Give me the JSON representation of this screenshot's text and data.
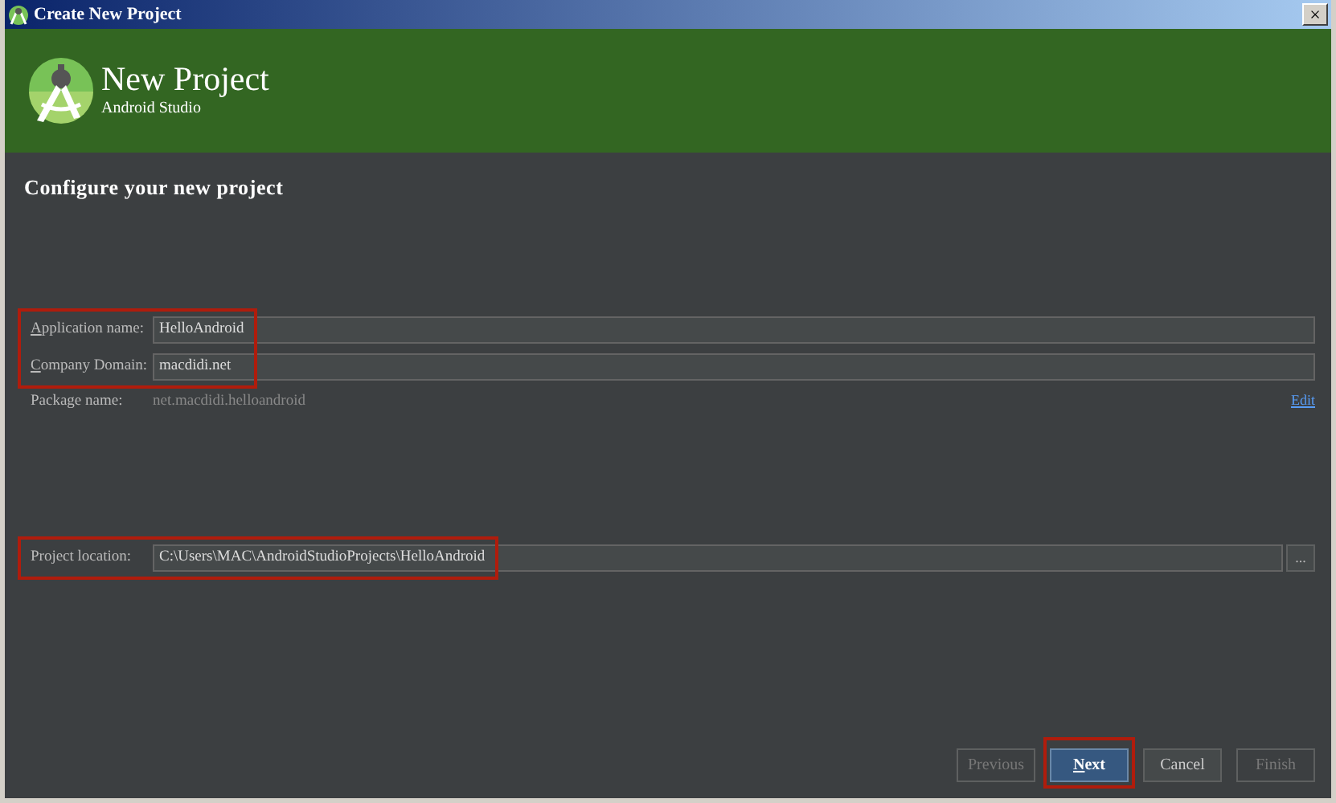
{
  "window": {
    "title": "Create New Project",
    "close": "×"
  },
  "header": {
    "title": "New Project",
    "subtitle": "Android Studio"
  },
  "heading": "Configure your new project",
  "groups": [
    {
      "highlighted": true,
      "fields": [
        {
          "kind": "input",
          "label": "Application name:",
          "mnemonic": true,
          "value": "HelloAndroid"
        },
        {
          "kind": "input",
          "label": "Company Domain:",
          "mnemonic": true,
          "value": "macdidi.net"
        }
      ]
    },
    {
      "highlighted": false,
      "fields": [
        {
          "kind": "readonly",
          "label": "Package name:",
          "value": "net.macdidi.helloandroid",
          "link": "Edit"
        }
      ]
    },
    {
      "highlighted": true,
      "fields": [
        {
          "kind": "path",
          "label": "Project location:",
          "value": "C:\\Users\\MAC\\AndroidStudioProjects\\HelloAndroid",
          "browse": "..."
        }
      ]
    }
  ],
  "buttons": [
    {
      "label": "Previous",
      "disabled": true,
      "default": false,
      "highlighted": false
    },
    {
      "label": "Next",
      "disabled": false,
      "default": true,
      "highlighted": true
    },
    {
      "label": "Cancel",
      "disabled": false,
      "default": false,
      "highlighted": false
    },
    {
      "label": "Finish",
      "disabled": true,
      "default": false,
      "highlighted": false
    }
  ]
}
